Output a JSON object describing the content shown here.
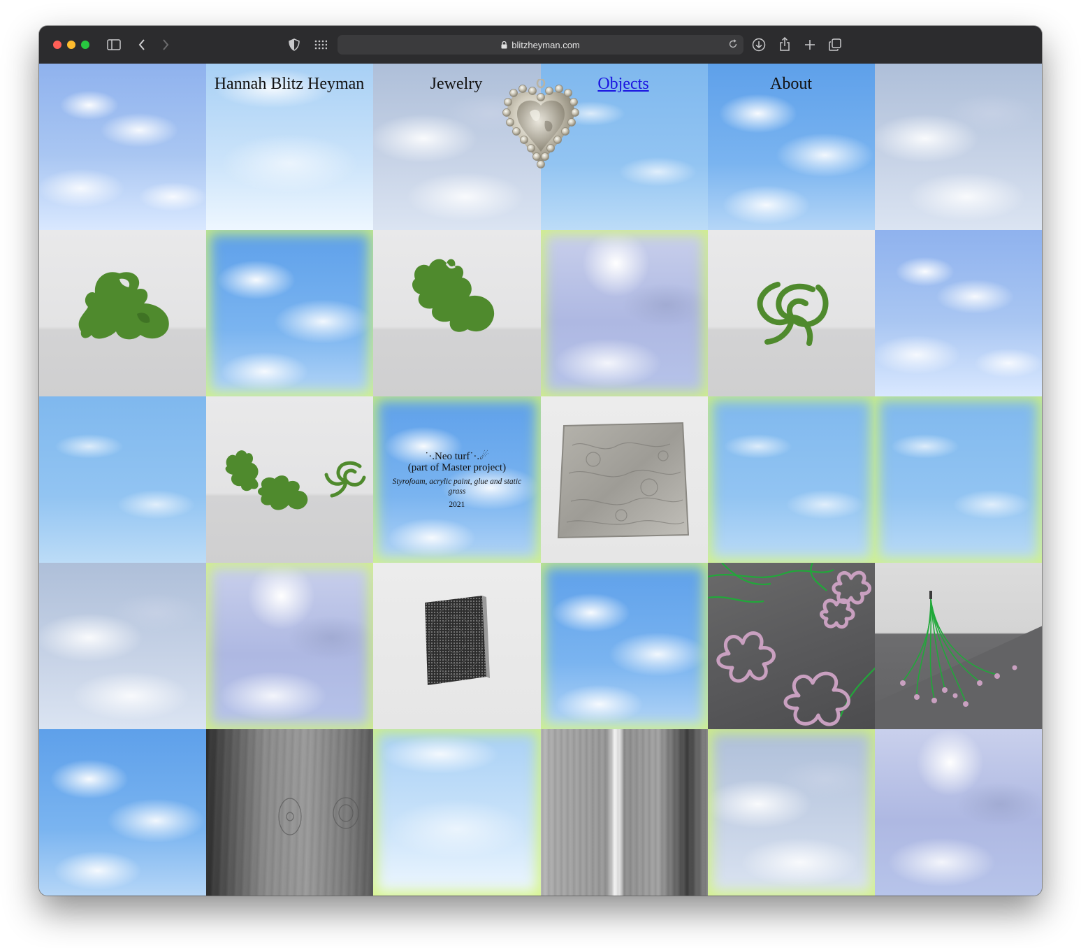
{
  "browser": {
    "url": "blitzheyman.com"
  },
  "nav": {
    "site_name": "Hannah Blitz Heyman",
    "items": [
      {
        "label": "Jewelry"
      },
      {
        "label": "Objects"
      },
      {
        "label": "About"
      }
    ],
    "active_item": "Objects"
  },
  "featured": {
    "title": "˙·.Neo turf˙·.☄",
    "subtitle": "(part of Master project)",
    "materials": "Styrofoam, acrylic paint, glue and static grass",
    "year": "2021"
  },
  "colors": {
    "link_active": "#1a14e0",
    "glow": "#d2f578",
    "turf_green": "#4f8a2d",
    "cord_green": "#21a83a",
    "flower_pink": "#c9a0c0"
  },
  "icons": [
    "sidebar-icon",
    "back-icon",
    "forward-icon",
    "shield-icon",
    "grid-icon",
    "lock-icon",
    "reload-icon",
    "download-icon",
    "share-icon",
    "new-tab-icon",
    "tabs-icon"
  ]
}
